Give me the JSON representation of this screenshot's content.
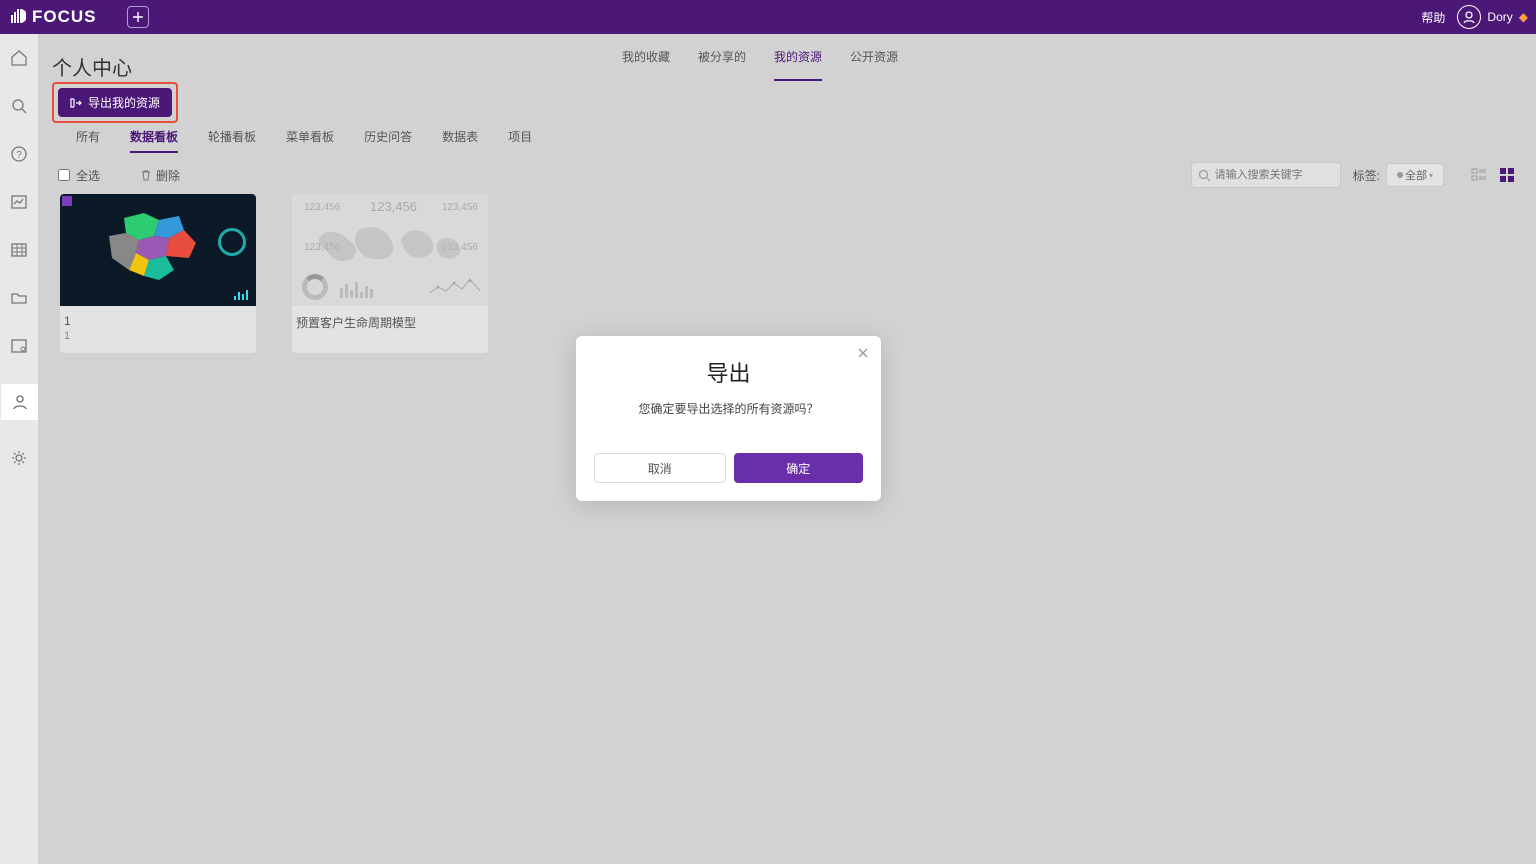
{
  "brand": "FOCUS",
  "topbar": {
    "help": "帮助",
    "user": "Dory"
  },
  "page_title": "个人中心",
  "nav_tabs": [
    "我的收藏",
    "被分享的",
    "我的资源",
    "公开资源"
  ],
  "nav_active": 2,
  "export_btn": "导出我的资源",
  "sub_tabs": [
    "所有",
    "数据看板",
    "轮播看板",
    "菜单看板",
    "历史问答",
    "数据表",
    "项目"
  ],
  "sub_active": 1,
  "select_all": "全选",
  "delete": "删除",
  "search_placeholder": "请输入搜索关键字",
  "tag_label": "标签:",
  "tag_value": "全部",
  "cards": [
    {
      "title": "1",
      "subtitle": "1"
    },
    {
      "title": "预置客户生命周期模型"
    }
  ],
  "thumb2_numbers": [
    "123,456",
    "123,456",
    "123,456",
    "123,456",
    "123,456"
  ],
  "modal": {
    "title": "导出",
    "message": "您确定要导出选择的所有资源吗？",
    "cancel": "取消",
    "ok": "确定"
  }
}
